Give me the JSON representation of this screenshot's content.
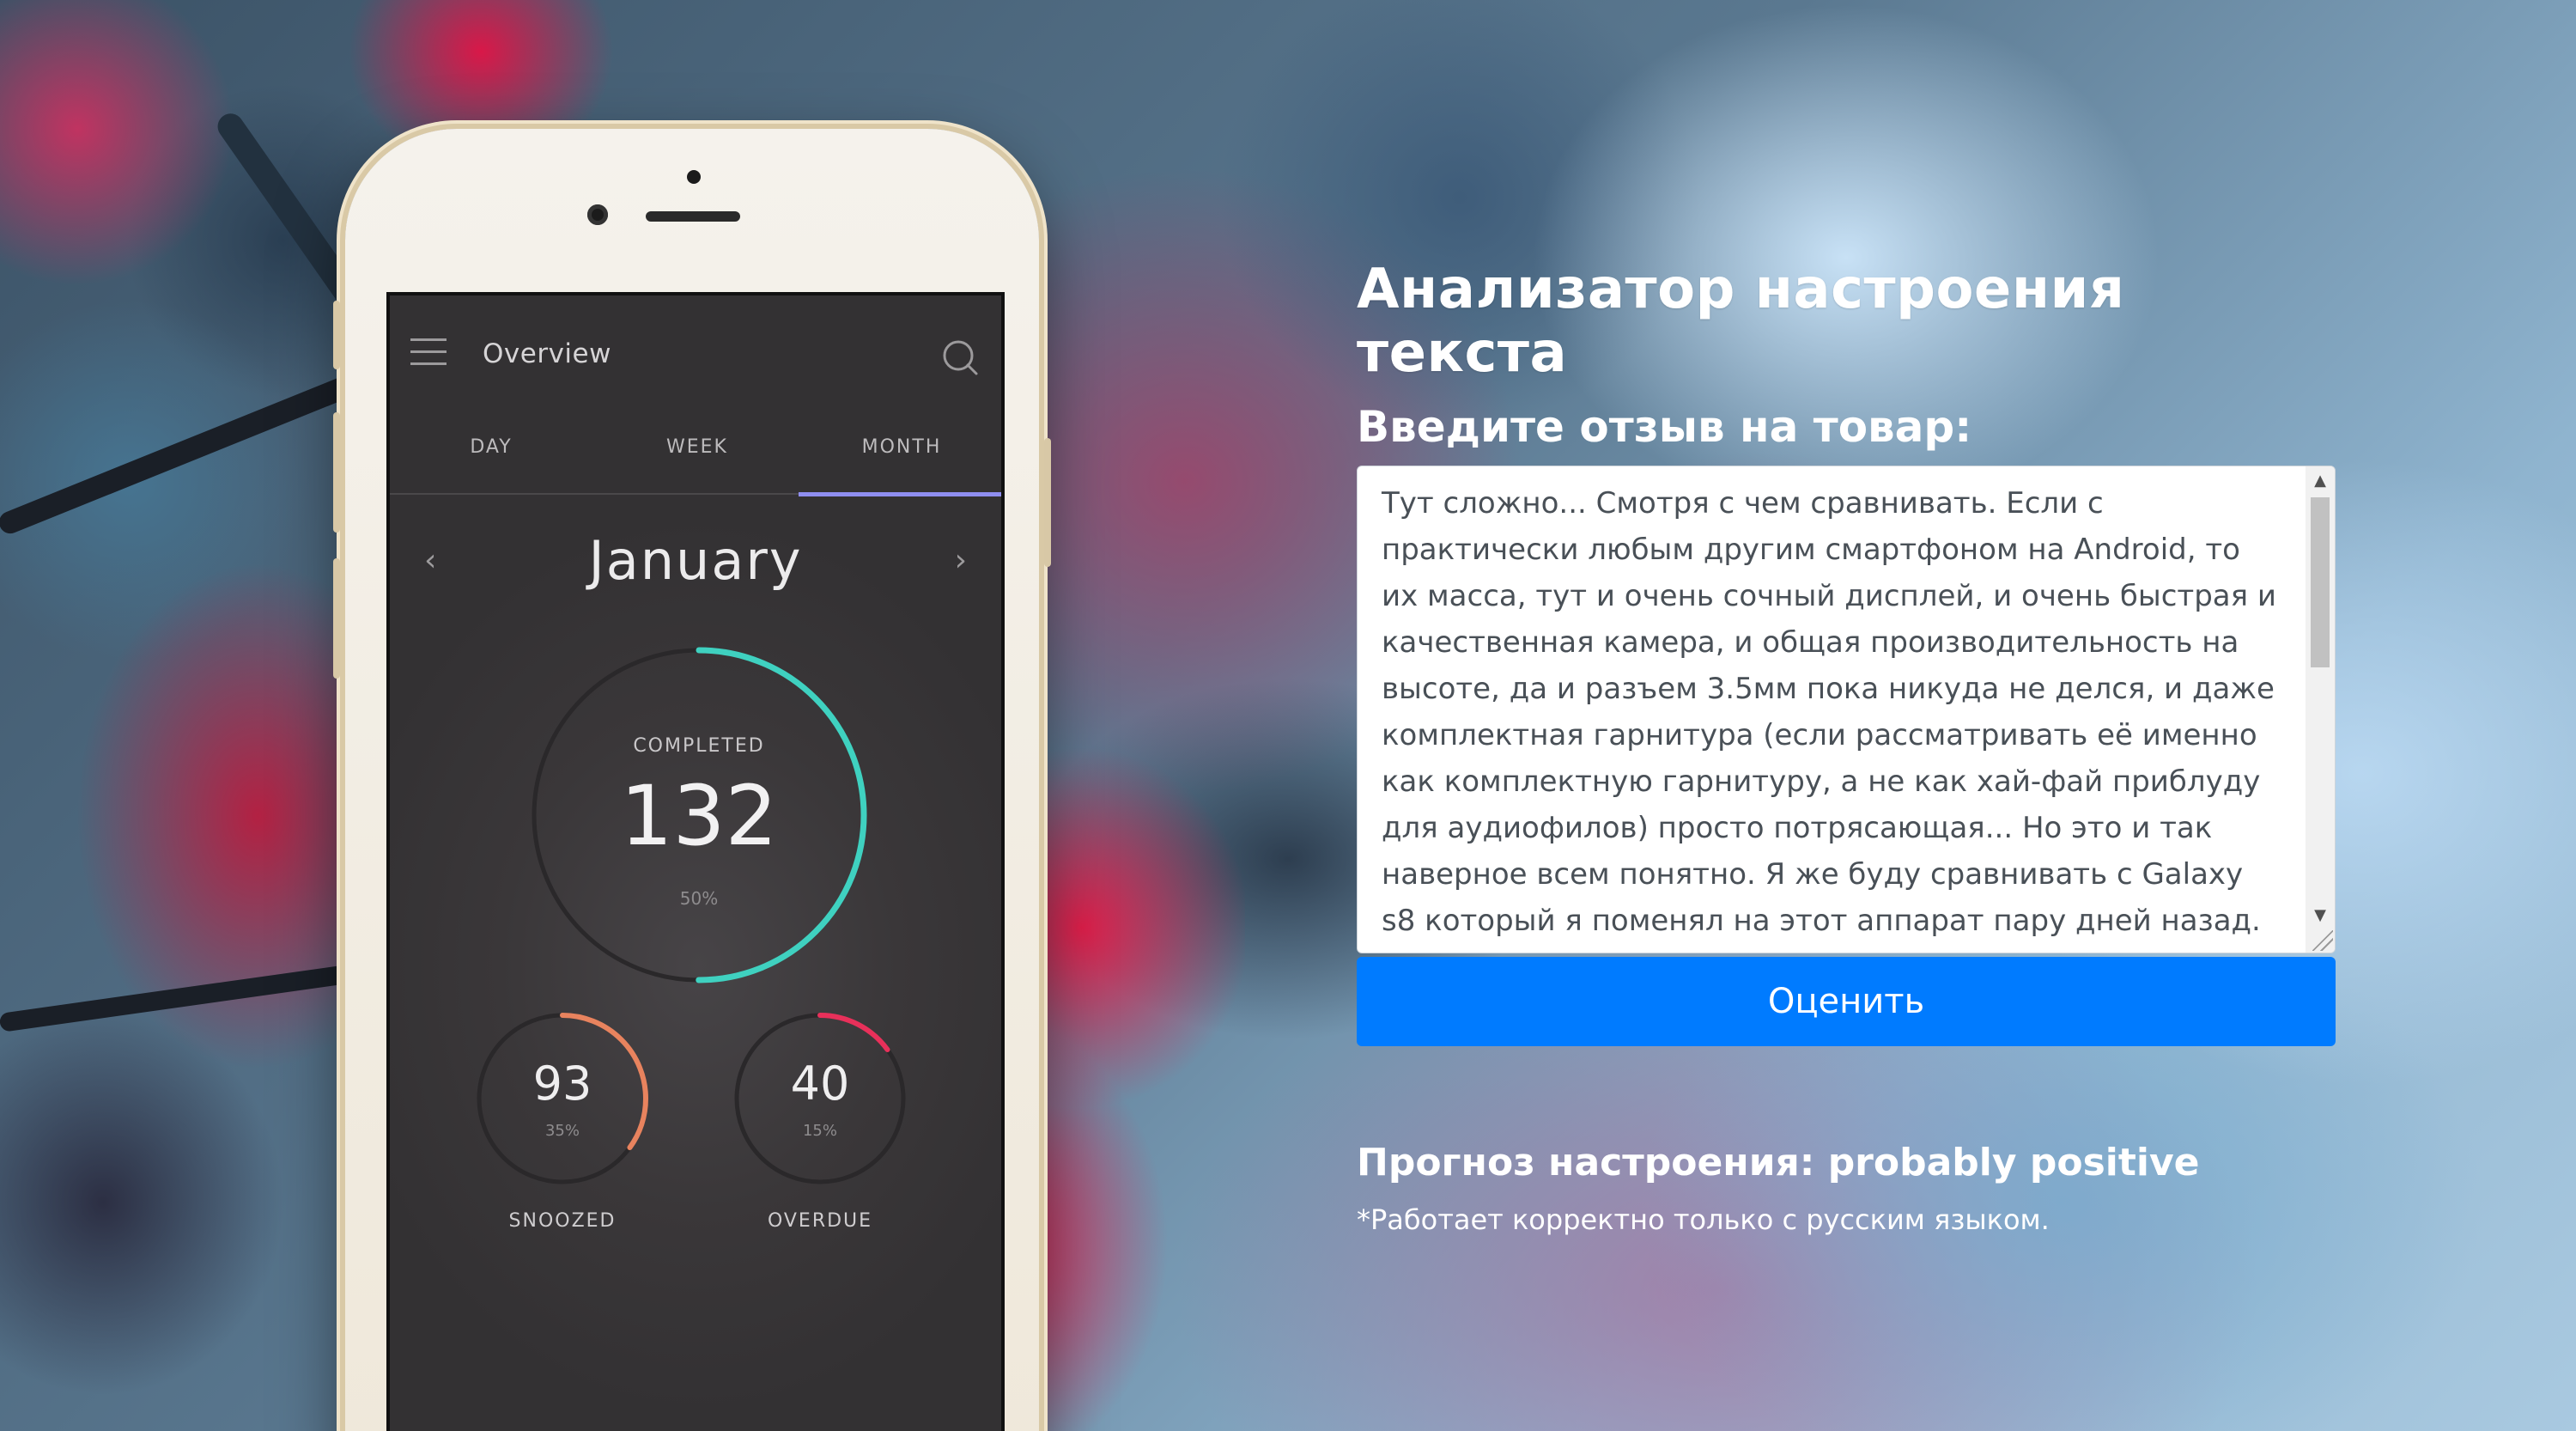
{
  "phone_app": {
    "title": "Overview",
    "tabs": [
      "DAY",
      "WEEK",
      "MONTH"
    ],
    "active_tab": "MONTH",
    "month": "January",
    "prev_icon": "chevron-left-icon",
    "next_icon": "chevron-right-icon",
    "main_ring": {
      "label": "COMPLETED",
      "value": "132",
      "percent": "50%",
      "fill_fraction": 0.5,
      "color": "#3fd1c0"
    },
    "snoozed": {
      "label": "SNOOZED",
      "value": "93",
      "percent": "35%",
      "fill_fraction": 0.35,
      "color": "#e8835e"
    },
    "overdue": {
      "label": "OVERDUE",
      "value": "40",
      "percent": "15%",
      "fill_fraction": 0.15,
      "color": "#e8305a"
    },
    "tab_accent": "#8f8ef0"
  },
  "main": {
    "title": "Анализатор настроения текста",
    "review_label": "Введите отзыв на товар:",
    "review_text": "Тут сложно... Смотря с чем сравнивать. Если с практически любым другим смартфоном на Android, то их масса, тут и очень сочный дисплей, и очень быстрая и качественная камера, и общая производительность на высоте, да и разъем 3.5мм пока никуда не делся, и даже комплектная гарнитура (если рассматривать её именно как комплектную гарнитуру, а не как хай-фай приблуду для аудиофилов) просто потрясающая... Но это и так наверное всем понятно. Я же буду сравнивать с Galaxy s8 который я поменял на этот аппарат пару дней назад.",
    "submit_label": "Оценить",
    "prediction": "Прогноз настроения: probably positive",
    "note": "*Работает корректно только с русским языком.",
    "button_color": "#007bff"
  }
}
